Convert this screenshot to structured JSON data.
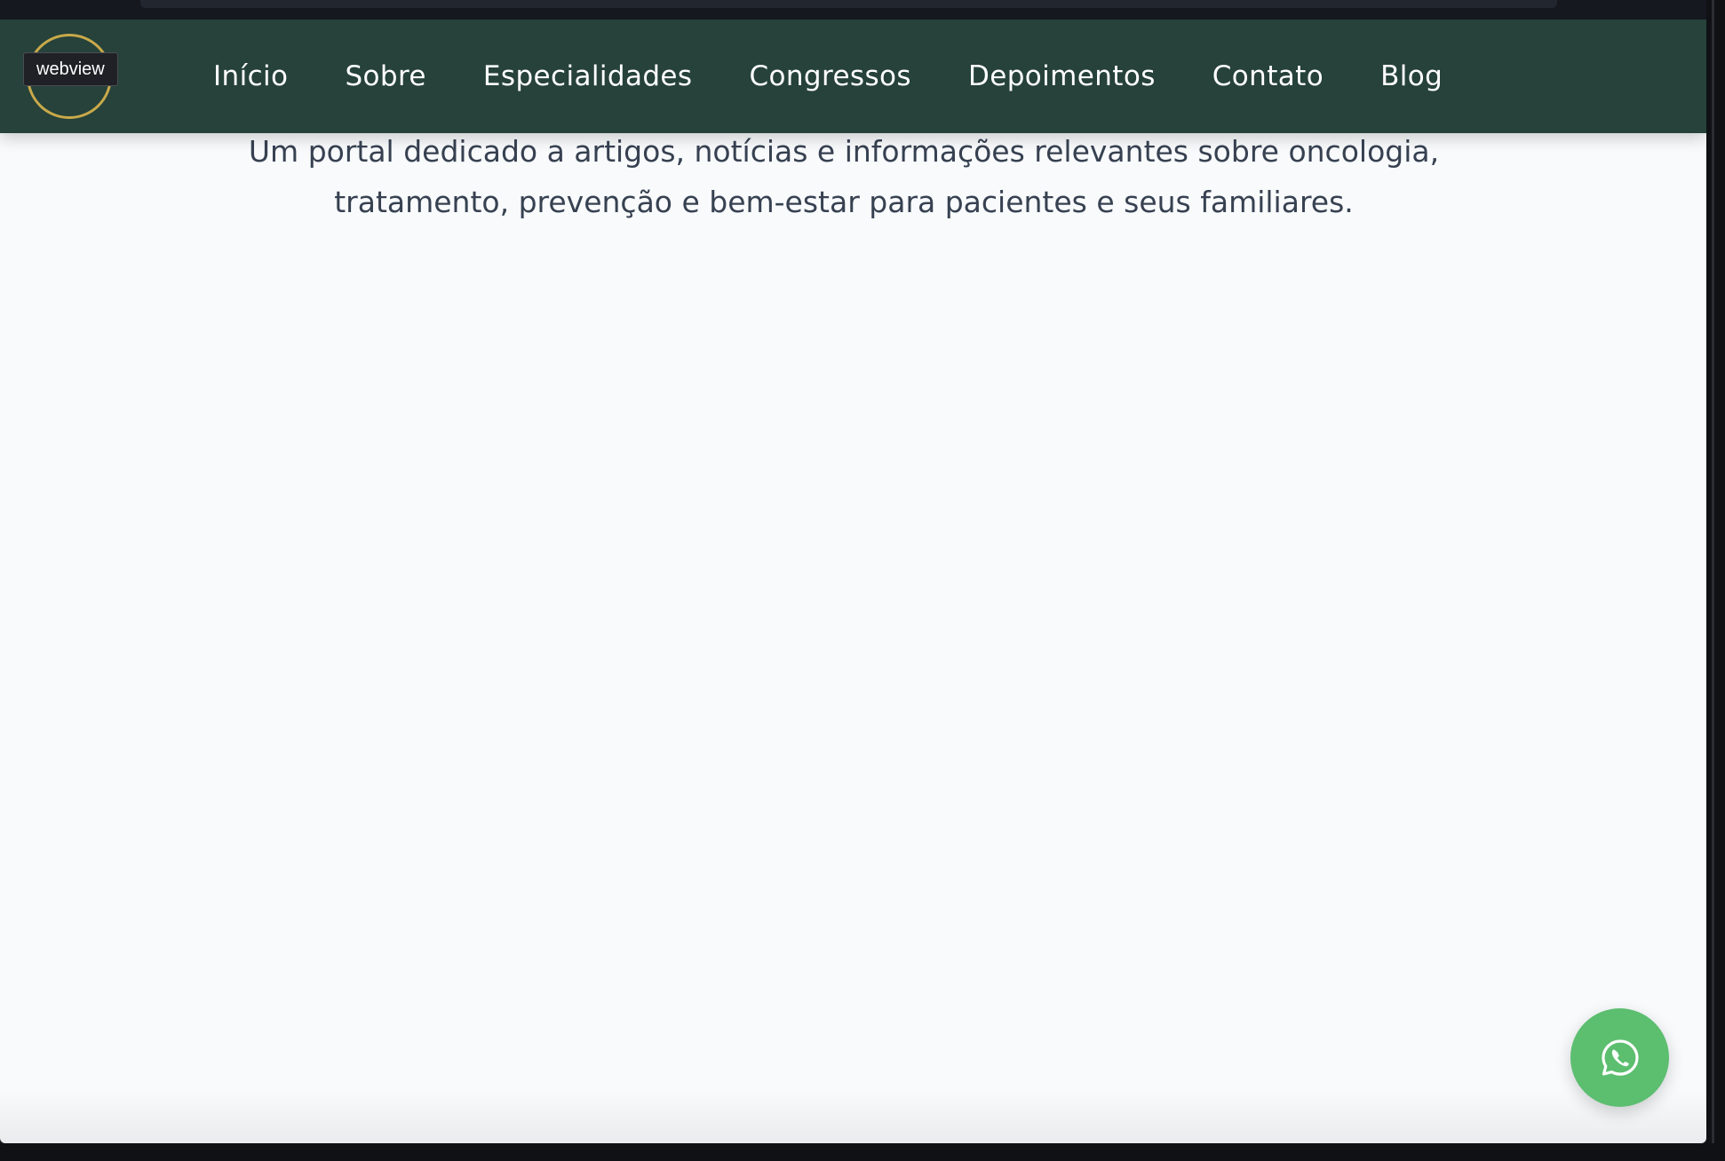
{
  "badge": {
    "label": "webview"
  },
  "navbar": {
    "items": [
      {
        "label": "Início"
      },
      {
        "label": "Sobre"
      },
      {
        "label": "Especialidades"
      },
      {
        "label": "Congressos"
      },
      {
        "label": "Depoimentos"
      },
      {
        "label": "Contato"
      },
      {
        "label": "Blog"
      }
    ]
  },
  "hero": {
    "line1": "Um portal dedicado a artigos, notícias e informações relevantes sobre oncologia,",
    "line2": "tratamento, prevenção e bem-estar para pacientes e seus familiares."
  },
  "floating_action": {
    "icon": "whatsapp-icon"
  },
  "colors": {
    "navbar_bg": "#26423a",
    "logo_ring": "#c9a94a",
    "whatsapp_green": "#5cbe6f",
    "page_bg": "#f8fafc",
    "body_text": "#374151"
  }
}
